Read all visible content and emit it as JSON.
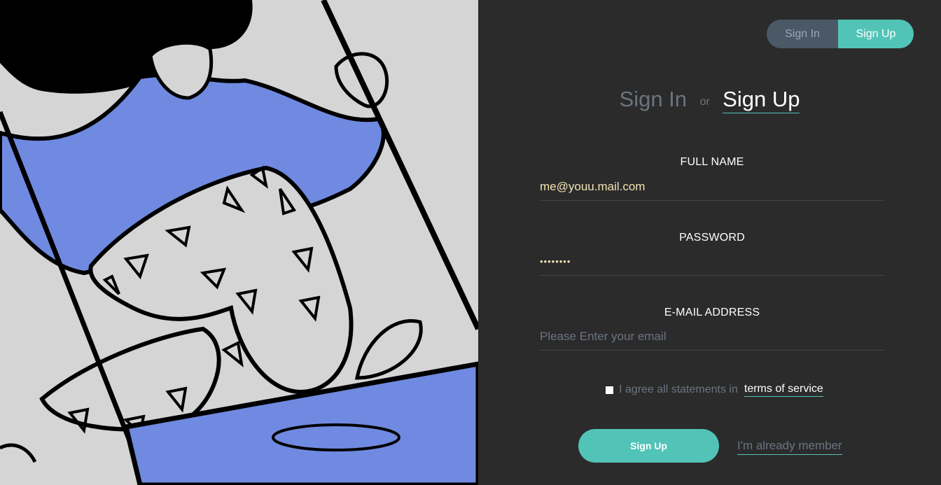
{
  "toggle": {
    "sign_in": "Sign In",
    "sign_up": "Sign Up"
  },
  "heading": {
    "sign_in": "Sign In",
    "or": "or",
    "sign_up": "Sign Up"
  },
  "form": {
    "full_name_label": "FULL NAME",
    "full_name_value": "me@youu.mail.com",
    "password_label": "PASSWORD",
    "password_value": "••••••••",
    "email_label": "E-MAIL ADDRESS",
    "email_placeholder": "Please Enter your email"
  },
  "agree": {
    "text": "I agree all statements in",
    "terms": "terms of service"
  },
  "actions": {
    "signup": "Sign Up",
    "member": "I'm already member"
  },
  "colors": {
    "accent": "#52c4b7",
    "panel": "#2b2b2b",
    "illustration_bg": "#d5d5d5",
    "illustration_blue": "#6f8ae0"
  }
}
